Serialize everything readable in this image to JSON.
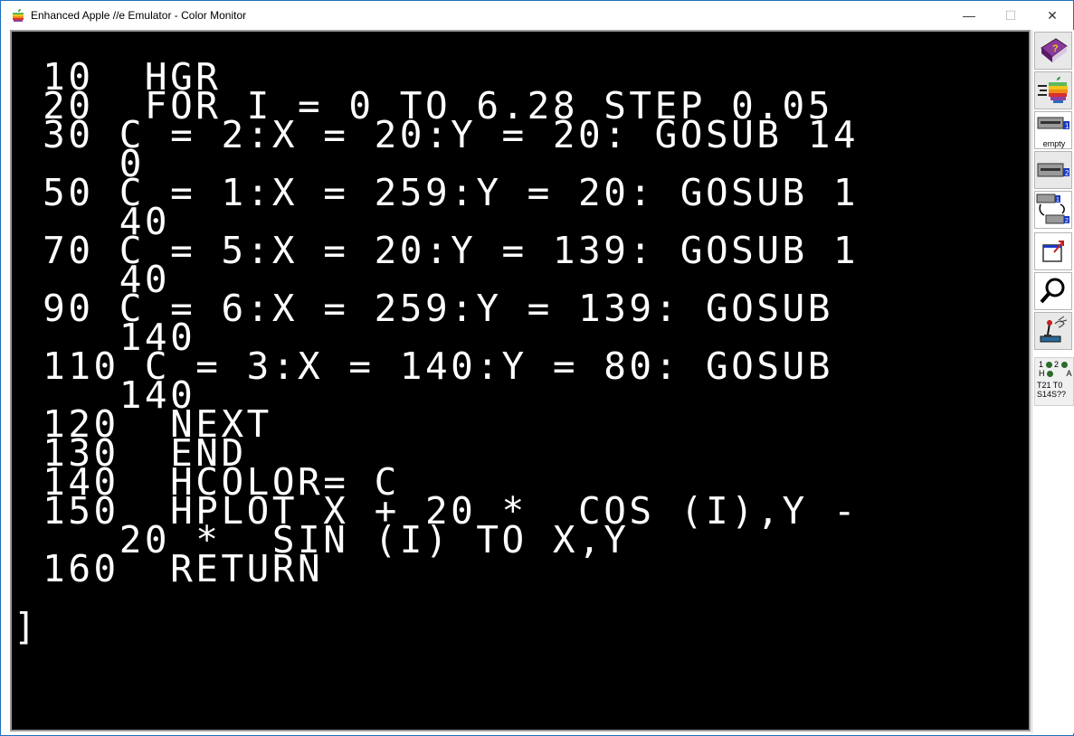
{
  "window": {
    "title": "Enhanced Apple //e Emulator - Color Monitor",
    "minimize_glyph": "—",
    "maximize_glyph": "☐",
    "close_glyph": "✕"
  },
  "screen": {
    "lines": [
      " 10  HGR",
      " 20  FOR I = 0 TO 6.28 STEP 0.05",
      " 30 C = 2:X = 20:Y = 20: GOSUB 14",
      "    0",
      " 50 C = 1:X = 259:Y = 20: GOSUB 1",
      "    40",
      " 70 C = 5:X = 20:Y = 139: GOSUB 1",
      "    40",
      " 90 C = 6:X = 259:Y = 139: GOSUB",
      "    140",
      " 110 C = 3:X = 140:Y = 80: GOSUB",
      "    140",
      " 120  NEXT",
      " 130  END",
      " 140  HCOLOR= C",
      " 150  HPLOT X + 20 *  COS (I),Y -",
      "    20 *  SIN (I) TO X,Y",
      " 160  RETURN"
    ],
    "prompt": "]"
  },
  "toolbar": {
    "buttons": [
      {
        "name": "help-button",
        "icon": "help-book-icon"
      },
      {
        "name": "run-button",
        "icon": "apple-run-icon"
      },
      {
        "name": "drive1-button",
        "icon": "disk-drive-1-icon",
        "label": "empty"
      },
      {
        "name": "drive2-button",
        "icon": "disk-drive-2-icon"
      },
      {
        "name": "swap-drives-button",
        "icon": "swap-drives-icon"
      },
      {
        "name": "fullscreen-button",
        "icon": "fullscreen-icon"
      },
      {
        "name": "debugger-button",
        "icon": "magnifier-icon"
      },
      {
        "name": "settings-button",
        "icon": "joystick-settings-icon"
      }
    ],
    "drive1_label": "empty",
    "status": {
      "row1_left": "1",
      "row1_right": "2",
      "row2_left": "H",
      "row2_right": "A",
      "track_line": "T21 T0",
      "sector_line": "S14S??"
    }
  },
  "colors": {
    "screen_bg": "#000000",
    "screen_text": "#ffffff",
    "led_green": "#2c6b2c"
  }
}
